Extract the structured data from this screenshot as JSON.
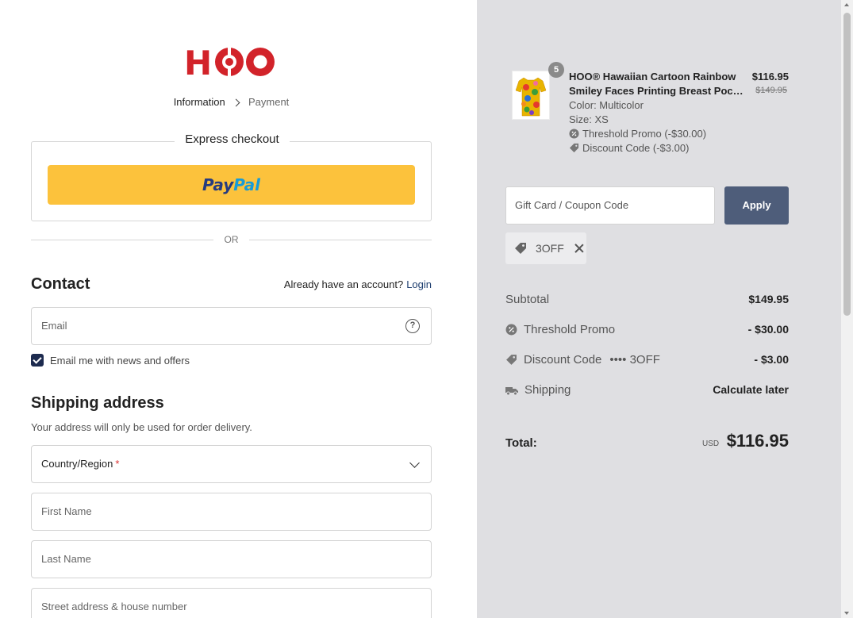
{
  "brand": {
    "name": "HOO",
    "color": "#d2232a"
  },
  "breadcrumb": {
    "step1": "Information",
    "step2": "Payment"
  },
  "express": {
    "title": "Express checkout",
    "paypal_part1": "Pay",
    "paypal_part2": "Pal"
  },
  "divider": {
    "or": "OR"
  },
  "contact": {
    "title": "Contact",
    "account_question": "Already have an account?",
    "login_label": "Login",
    "email_placeholder": "Email",
    "newsletter_label": "Email me with news and offers",
    "newsletter_checked": true
  },
  "shipping": {
    "title": "Shipping address",
    "subtitle": "Your address will only be used for order delivery.",
    "country_label": "Country/Region",
    "required_mark": "*",
    "first_name_placeholder": "First Name",
    "last_name_placeholder": "Last Name",
    "street_placeholder": "Street address & house number"
  },
  "cart": {
    "quantity": "5",
    "title_line1": "HOO® Hawaiian Cartoon Rainbow",
    "title_line2": "Smiley Faces Printing Breast Pocket...",
    "price": "$116.95",
    "original_price": "$149.95",
    "color": "Color: Multicolor",
    "size": "Size: XS",
    "promo1": "Threshold Promo  (-$30.00)",
    "promo2": "Discount Code  (-$3.00)"
  },
  "coupon": {
    "placeholder": "Gift Card / Coupon Code",
    "apply_label": "Apply",
    "applied_code": "3OFF"
  },
  "summary": {
    "subtotal_label": "Subtotal",
    "subtotal_value": "$149.95",
    "threshold_label": "Threshold Promo",
    "threshold_value": "- $30.00",
    "discount_label": "Discount Code",
    "discount_code_masked": "•••• 3OFF",
    "discount_value": "- $3.00",
    "shipping_label": "Shipping",
    "shipping_value": "Calculate later",
    "total_label": "Total:",
    "currency": "USD",
    "total_value": "$116.95"
  },
  "colors": {
    "accent": "#1d3d6e",
    "apply_button": "#4e5d7a",
    "paypal_yellow": "#fcc23c",
    "sidebar_bg": "#dfdfe2"
  }
}
